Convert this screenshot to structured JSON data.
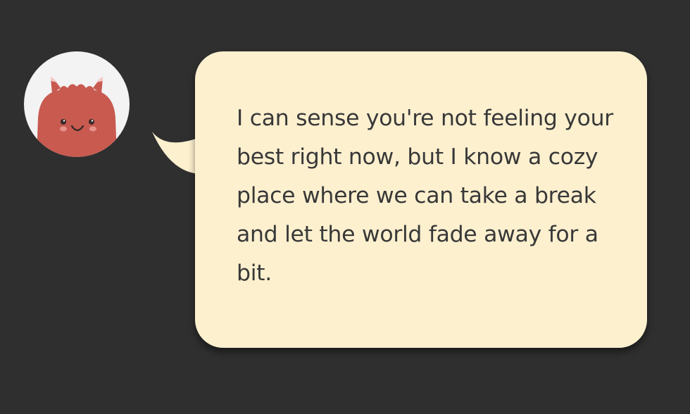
{
  "chat": {
    "avatar_icon": "red-monster-icon",
    "bubble_color": "#fdf0cf",
    "avatar_color": "#c85a50",
    "message": "I can sense you're not feeling your best right now, but I know a cozy place where we can take a break and let the world fade away for a bit."
  }
}
